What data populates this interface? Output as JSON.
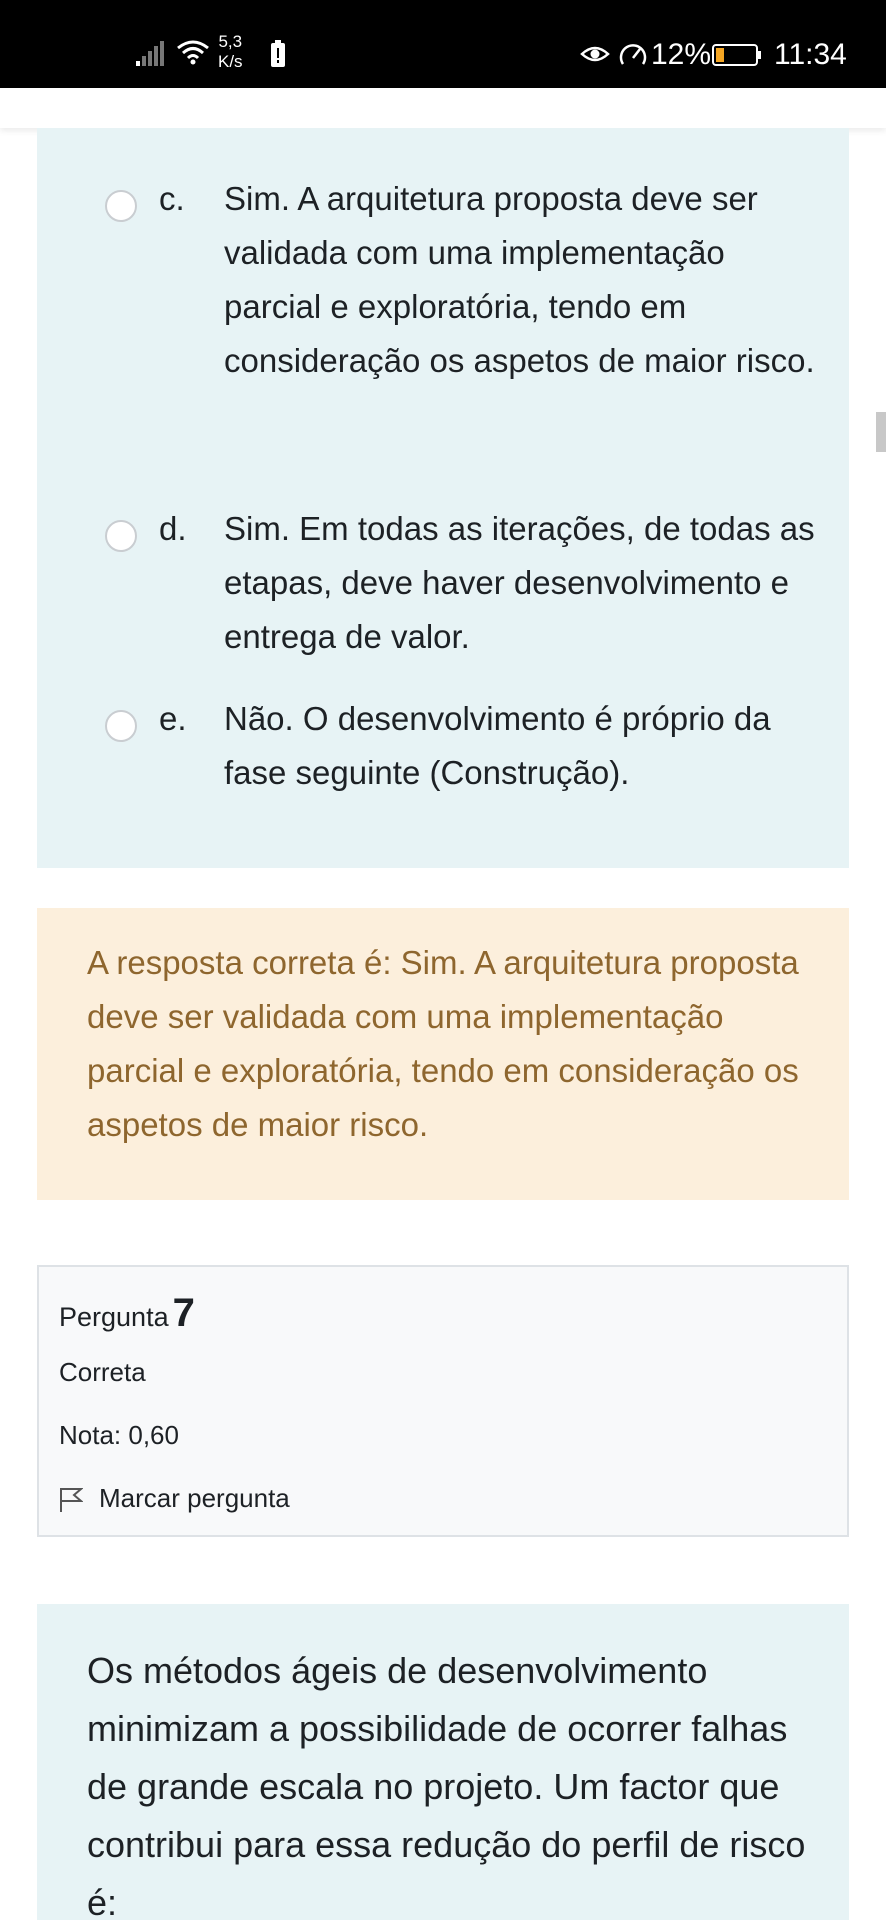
{
  "status_bar": {
    "network_speed_value": "5,3",
    "network_speed_unit": "K/s",
    "battery_percent": "12%",
    "time": "11:34",
    "icons": [
      "signal-icon",
      "wifi-icon",
      "alert-icon",
      "eye-icon",
      "gauge-icon",
      "battery-icon"
    ]
  },
  "options": [
    {
      "letter": "c.",
      "text": "Sim. A arquitetura proposta deve ser validada com uma implementação parcial e exploratória, tendo em consideração os aspetos de maior risco.",
      "selected": false
    },
    {
      "letter": "d.",
      "text": "Sim. Em todas as iterações, de todas as etapas, deve haver desenvolvimento e entrega de valor.",
      "selected": false
    },
    {
      "letter": "e.",
      "text": "Não. O desenvolvimento é próprio da fase seguinte (Construção).",
      "selected": false
    }
  ],
  "feedback": {
    "text": "A resposta correta é: Sim. A arquitetura proposta deve ser validada com uma implementação parcial e exploratória, tendo em consideração os aspetos de maior risco."
  },
  "question_info": {
    "label": "Pergunta",
    "number": "7",
    "status": "Correta",
    "grade": "Nota: 0,60",
    "flag_label": "Marcar pergunta"
  },
  "question_text": "Os métodos ágeis de desenvolvimento minimizam a possibilidade de ocorrer falhas de grande escala no projeto. Um factor que contribui para essa redução do perfil de risco é:",
  "colors": {
    "question_bg": "#e7f3f5",
    "feedback_bg": "#fcefdc",
    "feedback_text": "#8e662e",
    "info_bg": "#f8f9fa",
    "info_border": "#dee2e6"
  }
}
